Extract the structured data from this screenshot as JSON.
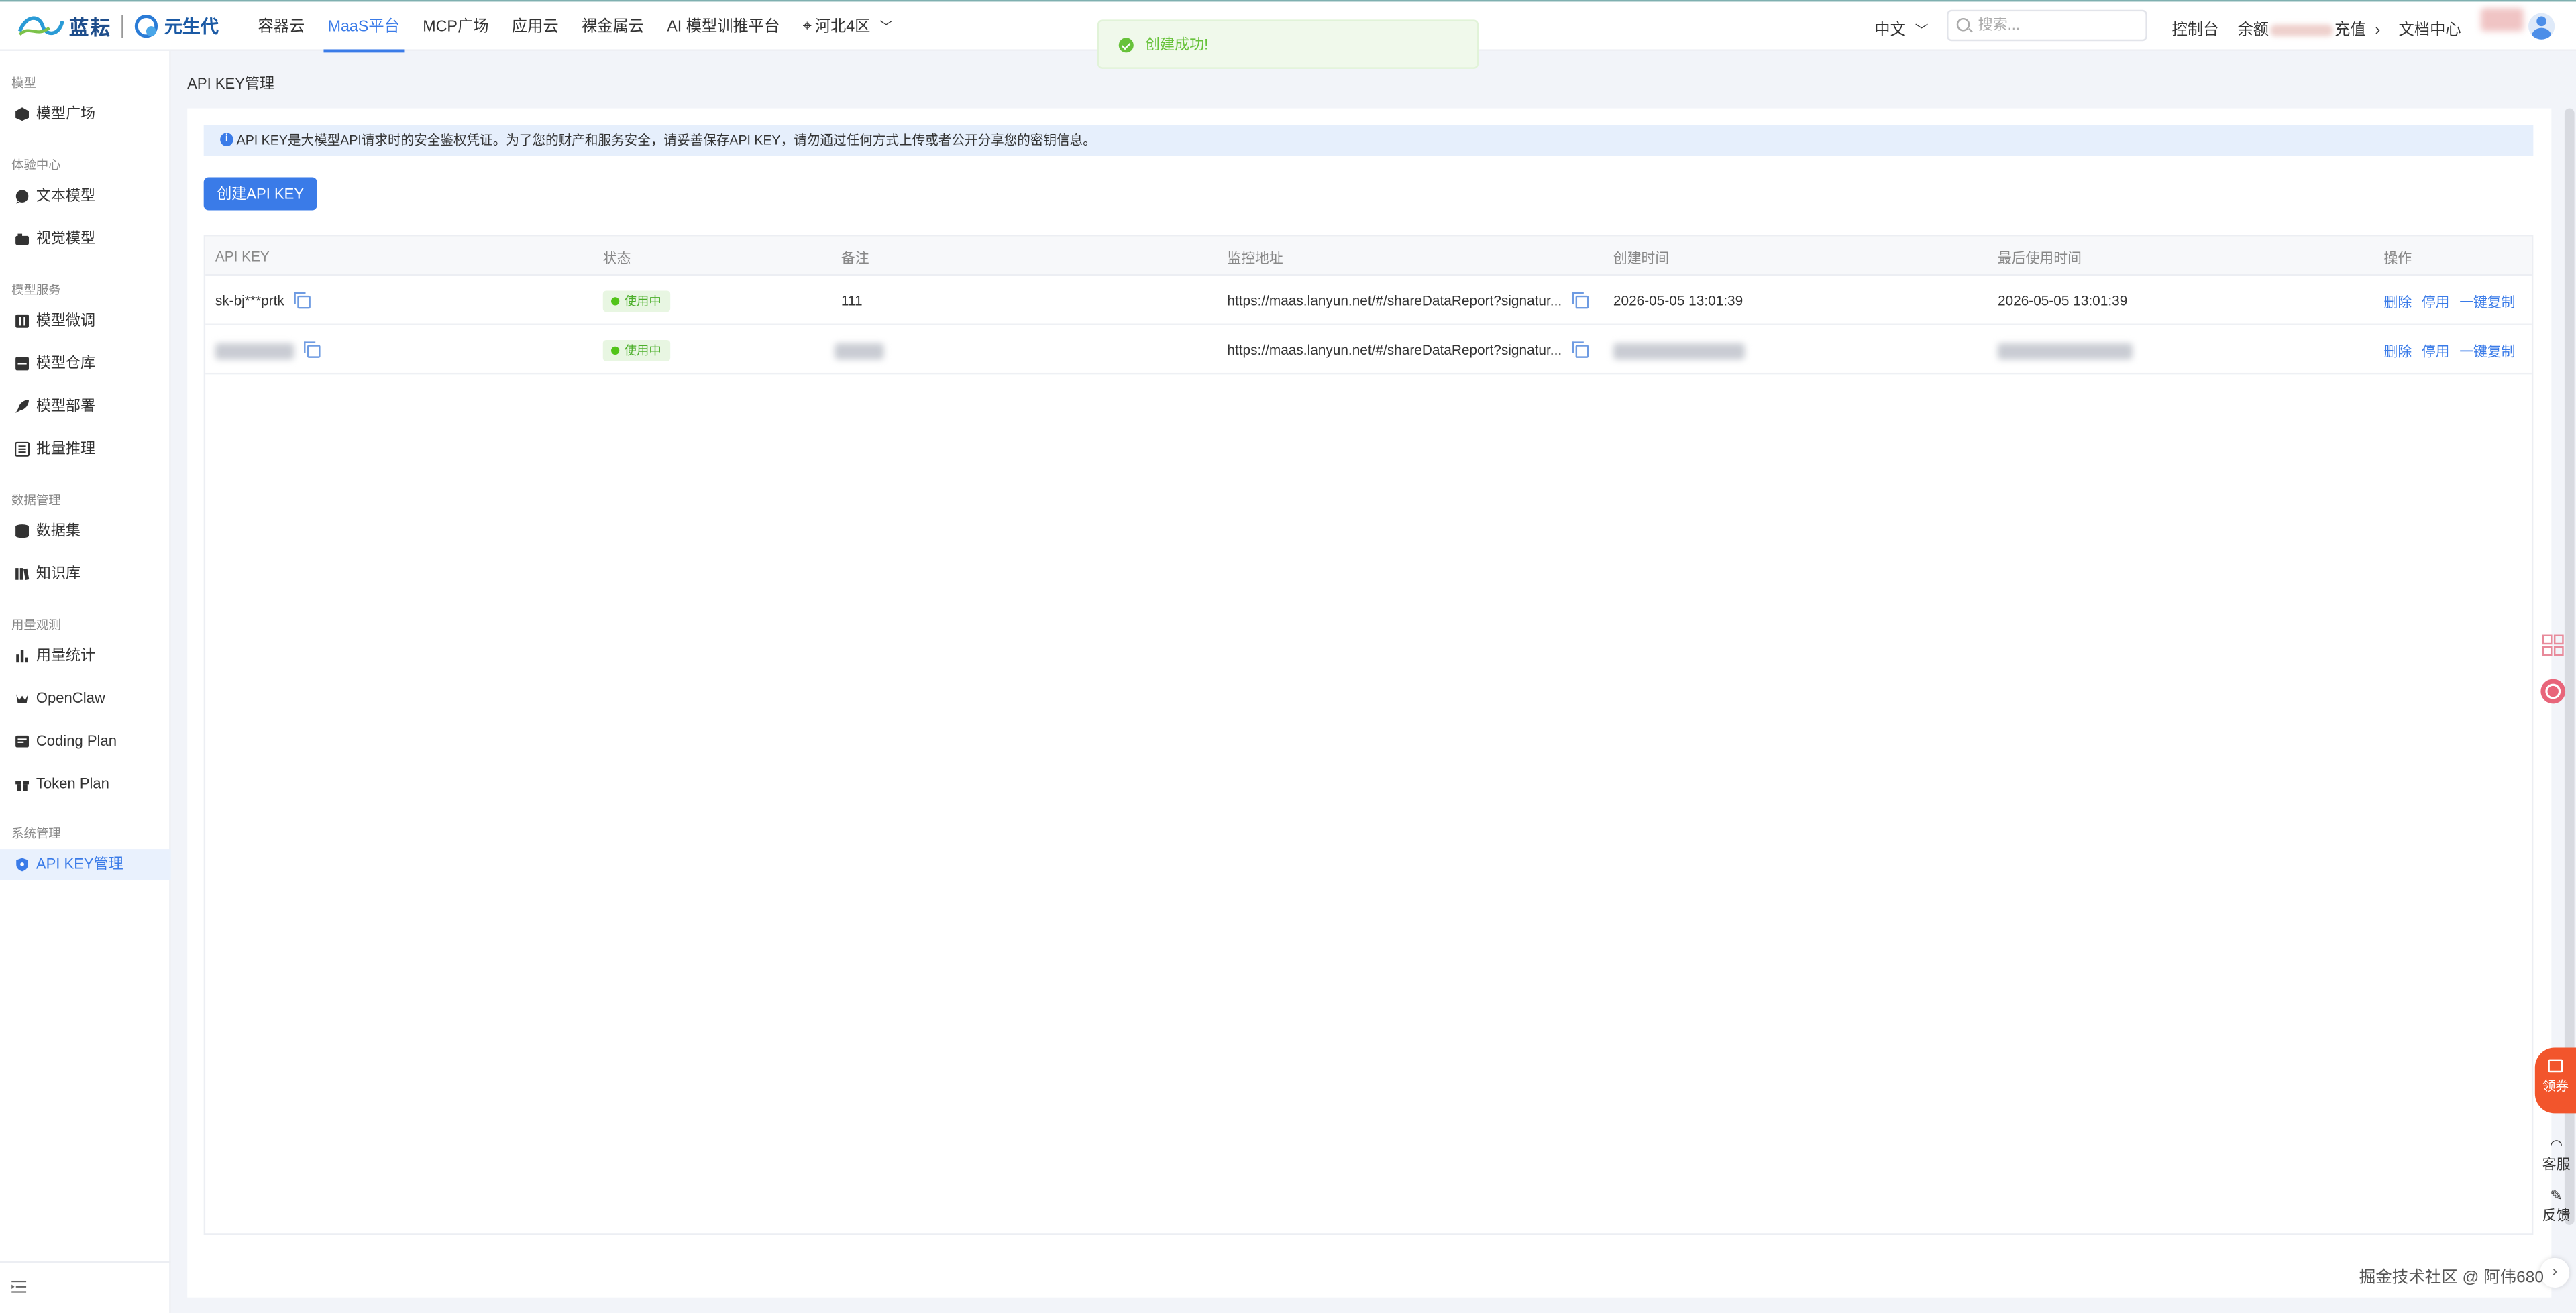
{
  "brand": {
    "name1": "蓝耘",
    "name2": "元生代"
  },
  "nav": {
    "links": [
      "容器云",
      "MaaS平台",
      "MCP广场",
      "应用云",
      "裸金属云",
      "AI 模型训推平台",
      "河北4区"
    ],
    "lang": "中文",
    "search_placeholder": "搜索...",
    "console": "控制台",
    "balance_prefix": "余额",
    "recharge": "充值",
    "docs": "文档中心"
  },
  "toast": {
    "text": "创建成功!"
  },
  "sidebar": {
    "groups": [
      "模型",
      "体验中心",
      "模型服务",
      "数据管理",
      "用量观测",
      "系统管理"
    ],
    "items": [
      "模型广场",
      "文本模型",
      "视觉模型",
      "模型微调",
      "模型仓库",
      "模型部署",
      "批量推理",
      "数据集",
      "知识库",
      "用量统计",
      "OpenClaw",
      "Coding Plan",
      "Token Plan",
      "API KEY管理"
    ]
  },
  "page": {
    "breadcrumb": "API KEY管理",
    "alert": "API KEY是大模型API请求时的安全鉴权凭证。为了您的财产和服务安全，请妥善保存API KEY，请勿通过任何方式上传或者公开分享您的密钥信息。",
    "create_button": "创建API KEY"
  },
  "table": {
    "headers": [
      "API KEY",
      "状态",
      "备注",
      "监控地址",
      "创建时间",
      "最后使用时间",
      "操作"
    ],
    "rows": [
      {
        "key": "sk-bj***prtk",
        "status": "使用中",
        "note": "111",
        "monitor": "https://maas.lanyun.net/#/shareDataReport?signatur...",
        "created": "2026-05-05 13:01:39",
        "last_used": "2026-05-05 13:01:39"
      },
      {
        "key": "",
        "status": "使用中",
        "note": "",
        "monitor": "https://maas.lanyun.net/#/shareDataReport?signatur...",
        "created": "",
        "last_used": ""
      }
    ],
    "actions": [
      "删除",
      "停用",
      "一键复制"
    ]
  },
  "floating": {
    "coupon": "领券",
    "service": "客服",
    "feedback": "反馈"
  },
  "watermark": "掘金技术社区 @ 阿伟680"
}
